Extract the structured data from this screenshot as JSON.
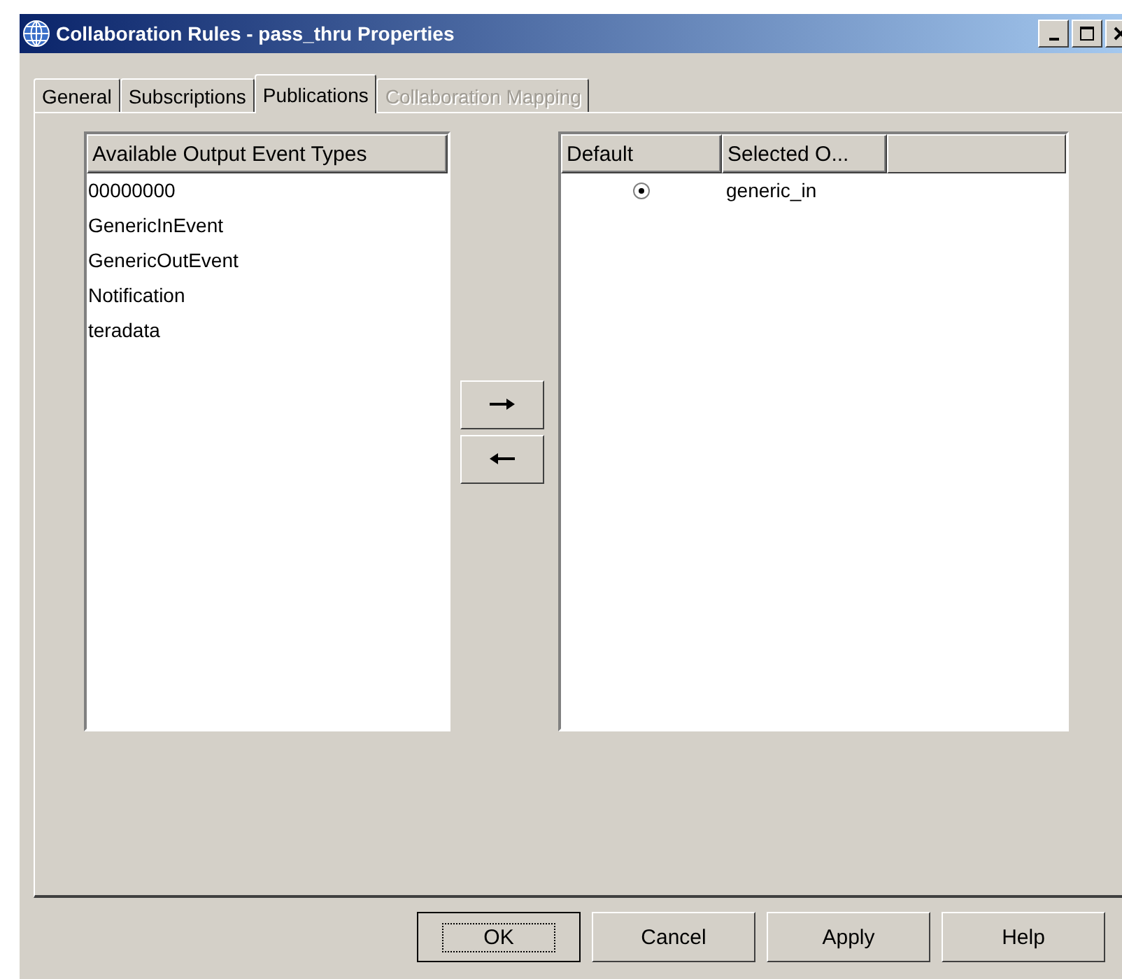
{
  "window": {
    "title": "Collaboration Rules - pass_thru Properties"
  },
  "tabs": [
    {
      "label": "General",
      "selected": false,
      "disabled": false
    },
    {
      "label": "Subscriptions",
      "selected": false,
      "disabled": false
    },
    {
      "label": "Publications",
      "selected": true,
      "disabled": false
    },
    {
      "label": "Collaboration Mapping",
      "selected": false,
      "disabled": true
    }
  ],
  "available_list": {
    "header": "Available Output Event Types",
    "items": [
      "00000000",
      "GenericInEvent",
      "GenericOutEvent",
      "Notification",
      "teradata"
    ]
  },
  "selected_table": {
    "columns": [
      "Default",
      "Selected O..."
    ],
    "rows": [
      {
        "default_selected": true,
        "name": "generic_in"
      }
    ]
  },
  "buttons": [
    {
      "label": "OK",
      "focused": true
    },
    {
      "label": "Cancel",
      "focused": false
    },
    {
      "label": "Apply",
      "focused": false
    },
    {
      "label": "Help",
      "focused": false
    }
  ]
}
